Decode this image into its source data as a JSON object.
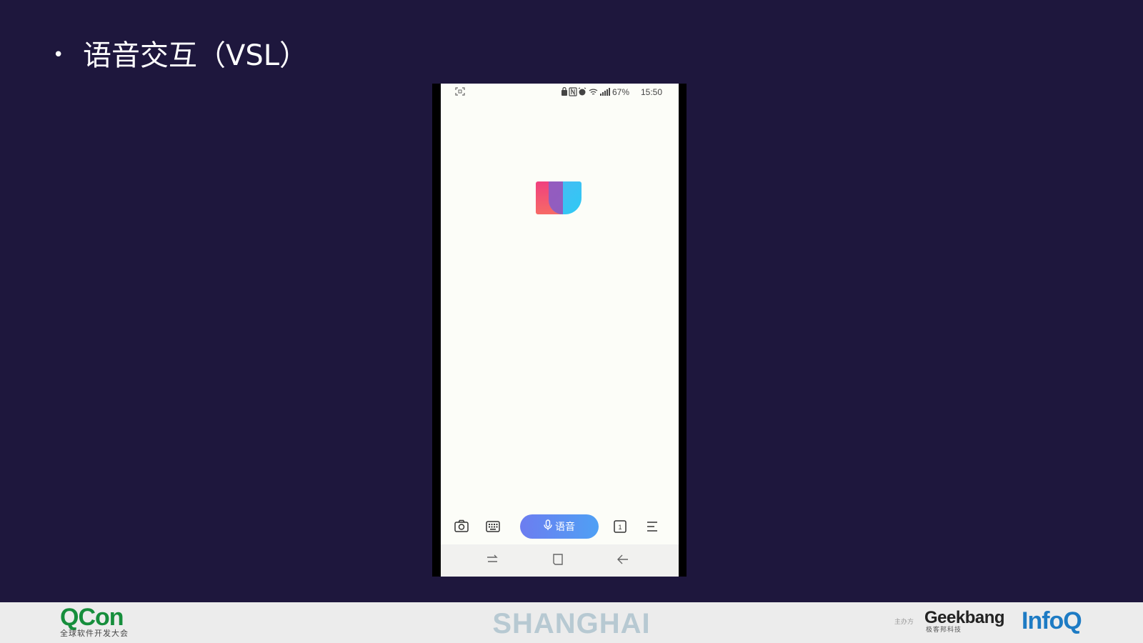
{
  "slide": {
    "bullet": "•",
    "title": "语音交互（VSL）"
  },
  "phone": {
    "status_bar": {
      "battery": "67%",
      "time": "15:50"
    },
    "toolbar": {
      "voice_button_label": "语音",
      "tab_count": "1"
    },
    "colors": {
      "voice_button_start": "#6c7df0",
      "voice_button_end": "#4fa0f4"
    }
  },
  "footer": {
    "qcon_logo": {
      "brand": "QCon",
      "tagline": "全球软件开发大会"
    },
    "city": "SHANGHAI",
    "organizer_label": "主办方",
    "geekbang_logo": {
      "brand": "Geekbang",
      "tagline": "极客邦科技"
    },
    "infoq_logo": "InfoQ"
  }
}
